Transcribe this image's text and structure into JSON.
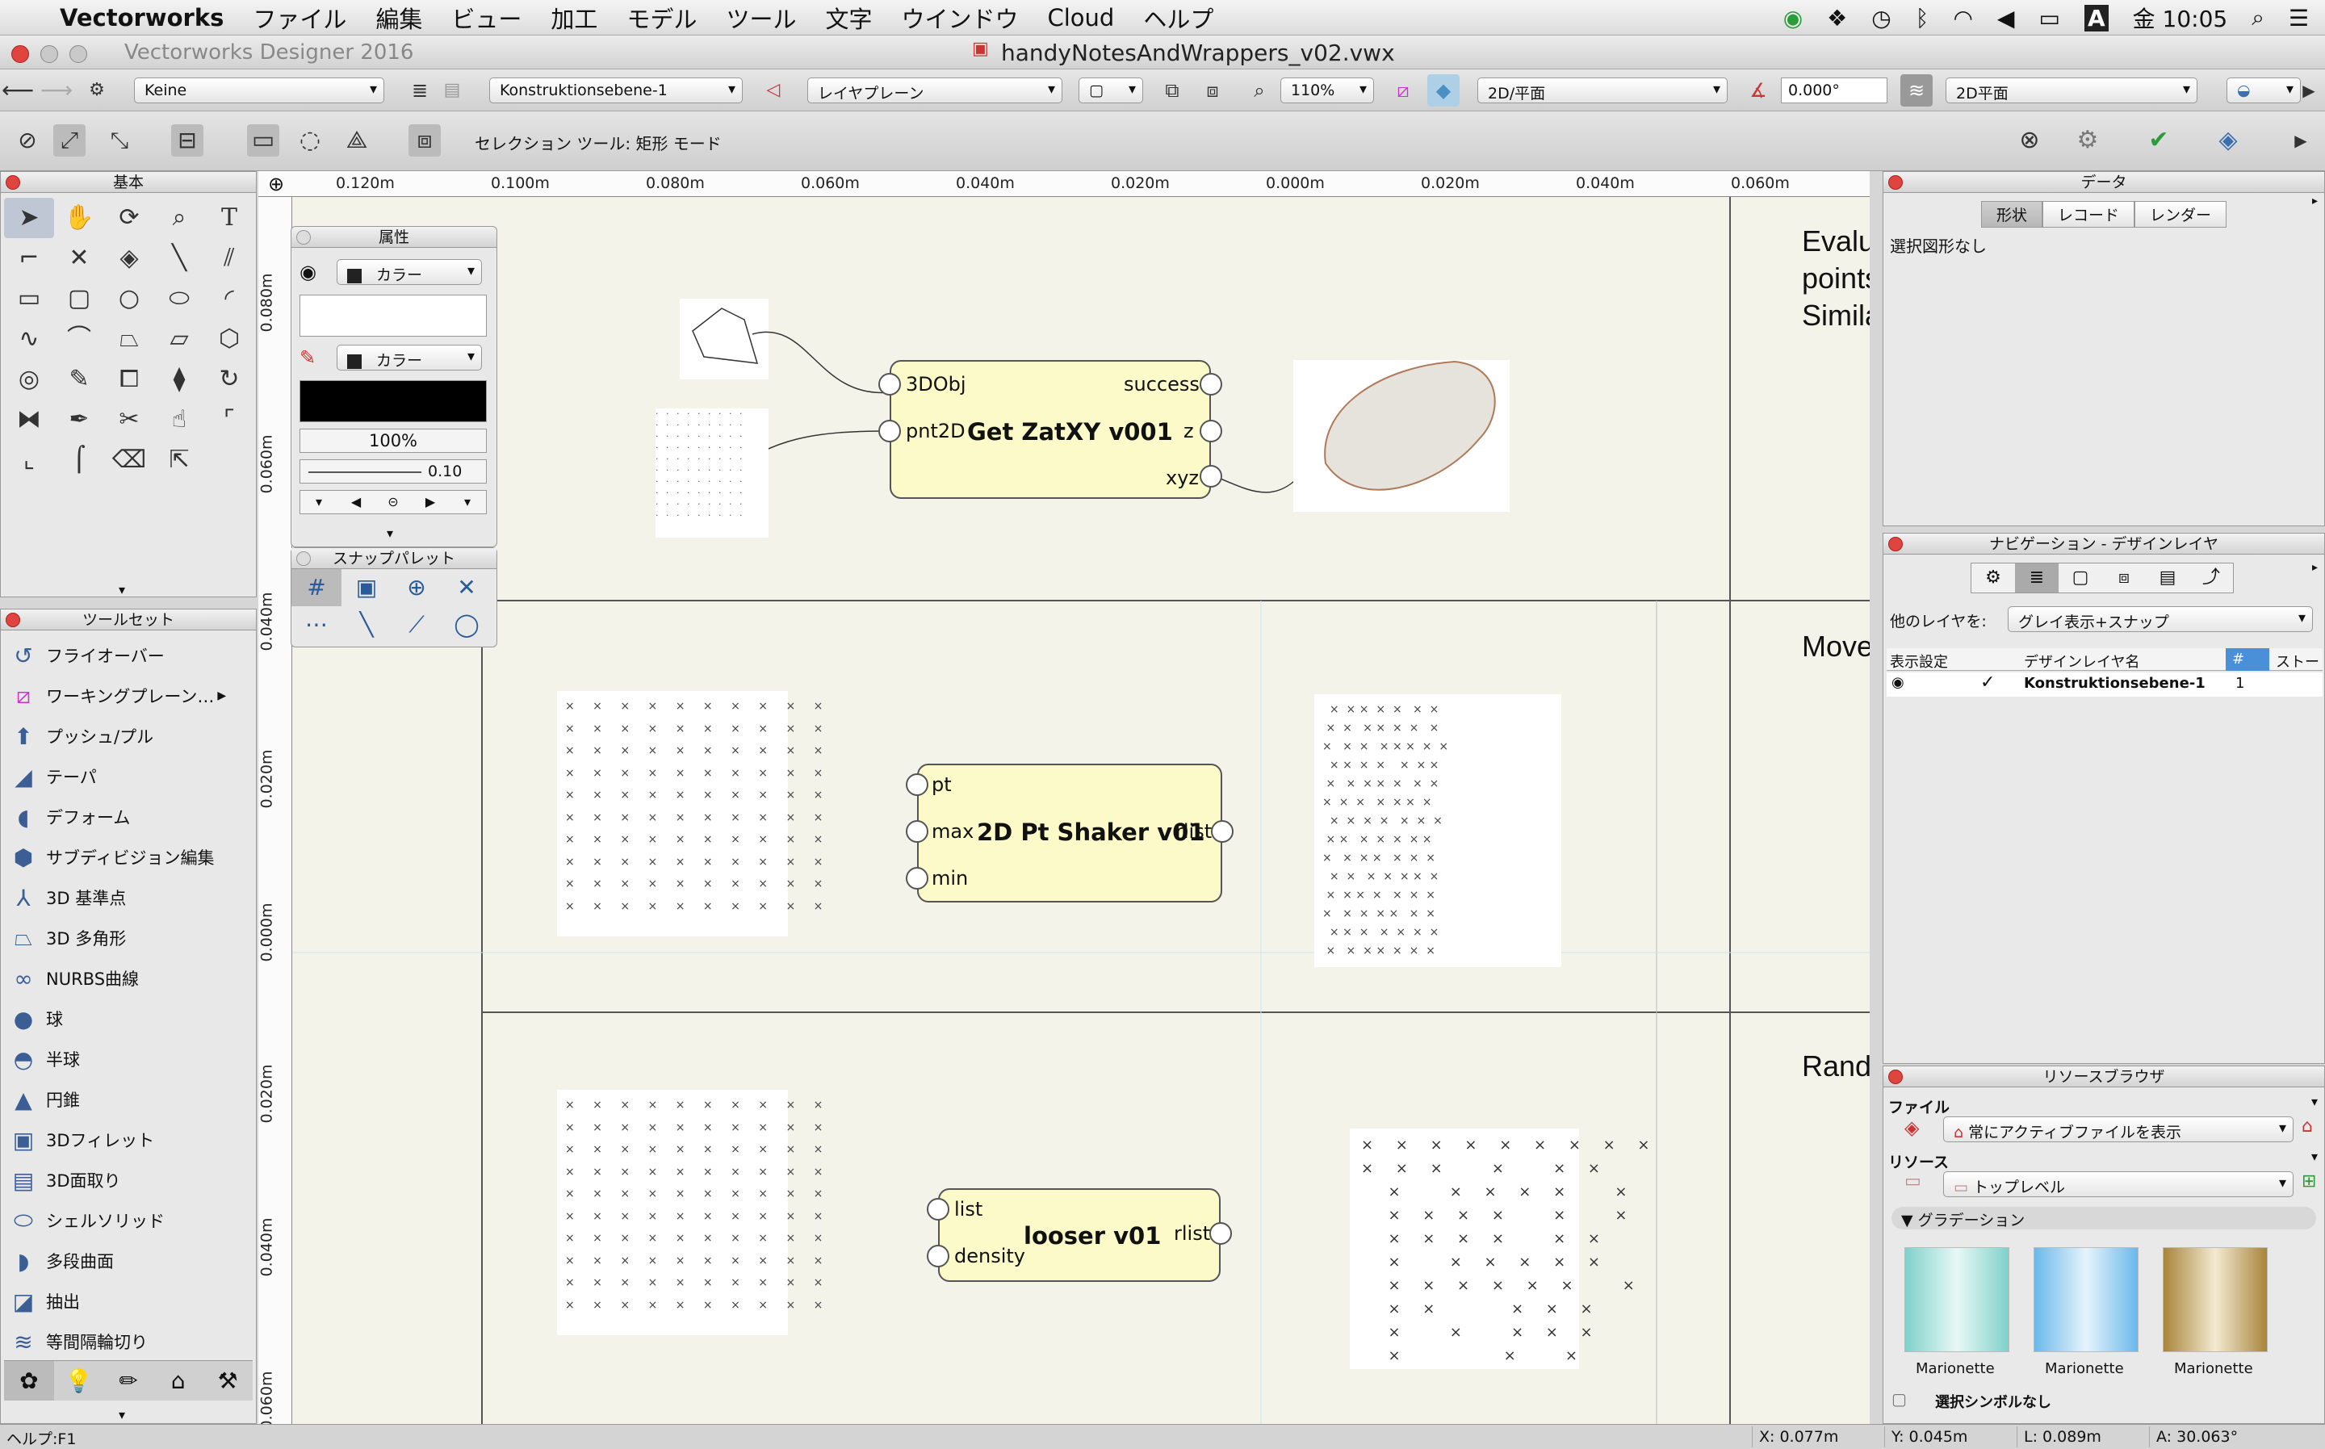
{
  "menubar": {
    "app": "Vectorworks",
    "items": [
      "ファイル",
      "編集",
      "ビュー",
      "加工",
      "モデル",
      "ツール",
      "文字",
      "ウインドウ",
      "Cloud",
      "ヘルプ"
    ],
    "clock": "金 10:05"
  },
  "window": {
    "app_title": "Vectorworks Designer 2016",
    "doc_title": "handyNotesAndWrappers_v02.vwx"
  },
  "toolbar1": {
    "class": "Keine",
    "layer": "Konstruktionsebene-1",
    "layer_plane": "レイヤプレーン",
    "zoom": "110%",
    "view": "2D/平面",
    "angle": "0.000°",
    "render": "2D平面"
  },
  "toolbar2": {
    "mode_text": "セレクション ツール: 矩形 モード"
  },
  "basic_palette": {
    "title": "基本"
  },
  "attr_palette": {
    "title": "属性",
    "fill": "カラー",
    "pen": "カラー",
    "opacity": "100%",
    "line_weight": "0.10"
  },
  "snap_palette": {
    "title": "スナップパレット"
  },
  "toolset_palette": {
    "title": "ツールセット",
    "items": [
      {
        "label": "フライオーバー",
        "icon": "flyover-icon"
      },
      {
        "label": "ワーキングプレーン…",
        "icon": "working-plane-icon"
      },
      {
        "label": "プッシュ/プル",
        "icon": "push-pull-icon"
      },
      {
        "label": "テーパ",
        "icon": "taper-icon"
      },
      {
        "label": "デフォーム",
        "icon": "deform-icon"
      },
      {
        "label": "サブディビジョン編集",
        "icon": "subdivision-icon"
      },
      {
        "label": "3D 基準点",
        "icon": "3d-locus-icon"
      },
      {
        "label": "3D 多角形",
        "icon": "3d-polygon-icon"
      },
      {
        "label": "NURBS曲線",
        "icon": "nurbs-curve-icon"
      },
      {
        "label": "球",
        "icon": "sphere-icon"
      },
      {
        "label": "半球",
        "icon": "hemisphere-icon"
      },
      {
        "label": "円錐",
        "icon": "cone-icon"
      },
      {
        "label": "3Dフィレット",
        "icon": "3d-fillet-icon"
      },
      {
        "label": "3D面取り",
        "icon": "3d-chamfer-icon"
      },
      {
        "label": "シェルソリッド",
        "icon": "shell-solid-icon"
      },
      {
        "label": "多段曲面",
        "icon": "loft-surface-icon"
      },
      {
        "label": "抽出",
        "icon": "extract-icon"
      },
      {
        "label": "等間隔輪切り",
        "icon": "contour-icon"
      }
    ]
  },
  "rulers": {
    "h": [
      "0.120m",
      "0.100m",
      "0.080m",
      "0.060m",
      "0.040m",
      "0.020m",
      "0.000m",
      "0.020m",
      "0.040m",
      "0.060m"
    ],
    "v": [
      "0.080m",
      "0.060m",
      "0.040m",
      "0.020m",
      "0.000m",
      "0.020m",
      "0.040m",
      "0.060m"
    ]
  },
  "canvas": {
    "section_labels": [
      "Evalu",
      "points",
      "Simila",
      "Move",
      "Rando"
    ],
    "nodes": [
      {
        "title": "Get ZatXY v001",
        "inputs": [
          "3DObj",
          "pnt2D"
        ],
        "outputs": [
          "success",
          "z",
          "xyz"
        ]
      },
      {
        "title": "2D Pt Shaker v01",
        "inputs": [
          "pt",
          "max",
          "min"
        ],
        "outputs": [
          "rlist"
        ]
      },
      {
        "title": "looser v01",
        "inputs": [
          "list",
          "density"
        ],
        "outputs": [
          "rlist"
        ]
      }
    ]
  },
  "data_panel": {
    "title": "データ",
    "tabs": [
      "形状",
      "レコード",
      "レンダー"
    ],
    "empty": "選択図形なし"
  },
  "nav_panel": {
    "title": "ナビゲーション - デザインレイヤ",
    "other_layers_label": "他のレイヤを:",
    "other_layers_value": "グレイ表示+スナップ",
    "cols": [
      "表示設定",
      "デザインレイヤ名",
      "#",
      "ストー"
    ],
    "row": {
      "check": "✓",
      "name": "Konstruktionsebene-1",
      "num": "1"
    }
  },
  "resource_panel": {
    "title": "リソースブラウザ",
    "file_label": "ファイル",
    "file_value": "常にアクティブファイルを表示",
    "res_label": "リソース",
    "res_value": "トップレベル",
    "group": "グラデーション",
    "items": [
      "Marionette",
      "Marionette",
      "Marionette"
    ],
    "footer": "選択シンボルなし"
  },
  "statusbar": {
    "help": "ヘルプ:F1",
    "x": "X: 0.077m",
    "y": "Y: 0.045m",
    "l": "L: 0.089m",
    "a": "A: 30.063°"
  }
}
